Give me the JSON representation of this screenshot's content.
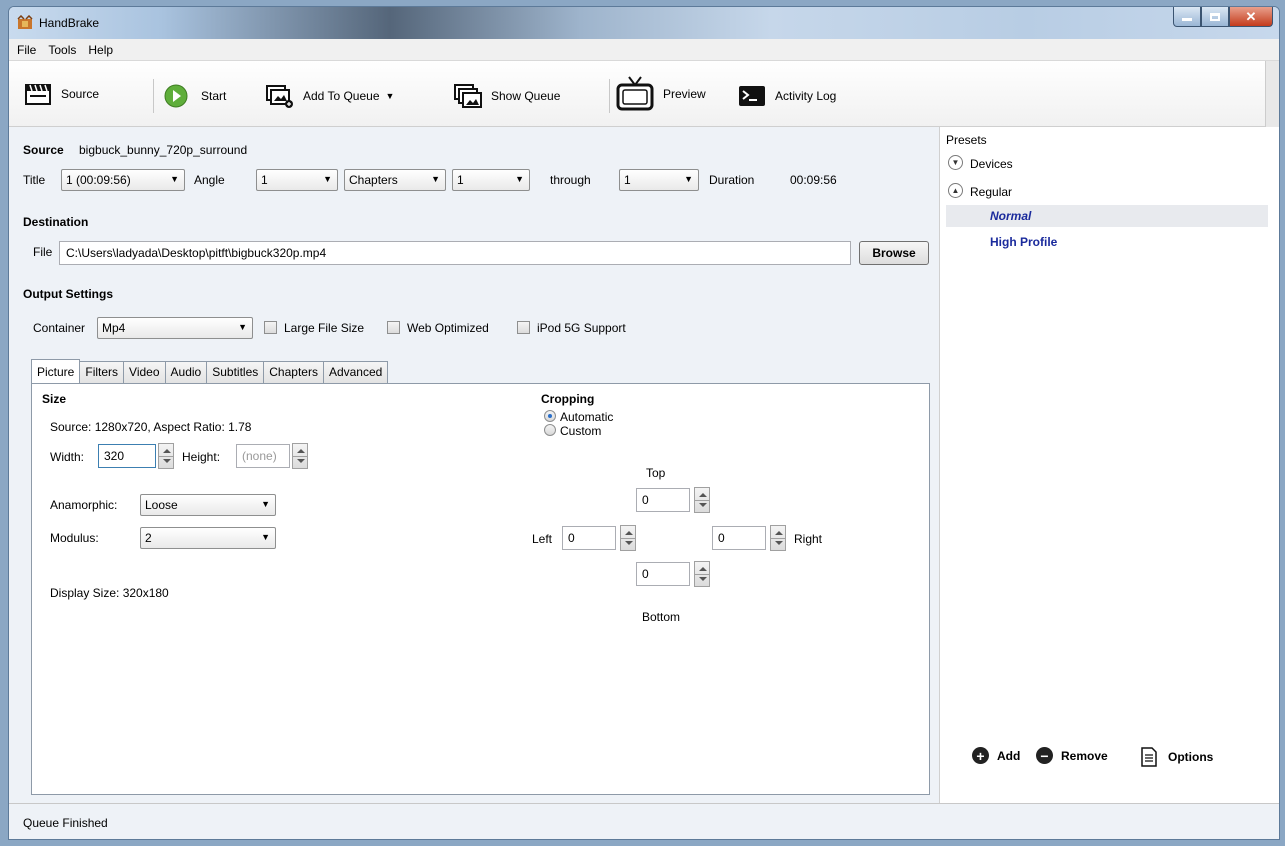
{
  "window": {
    "title": "HandBrake"
  },
  "menu": [
    "File",
    "Tools",
    "Help"
  ],
  "toolbar": {
    "source": "Source",
    "start": "Start",
    "add_to_queue": "Add To Queue",
    "show_queue": "Show Queue",
    "preview": "Preview",
    "activity_log": "Activity Log"
  },
  "source": {
    "label": "Source",
    "value": "bigbuck_bunny_720p_surround",
    "title_label": "Title",
    "title_value": "1 (00:09:56)",
    "angle_label": "Angle",
    "angle_value": "1",
    "range_mode": "Chapters",
    "range_start": "1",
    "through_label": "through",
    "range_end": "1",
    "duration_label": "Duration",
    "duration_value": "00:09:56"
  },
  "destination": {
    "heading": "Destination",
    "file_label": "File",
    "file_path": "C:\\Users\\ladyada\\Desktop\\pitft\\bigbuck320p.mp4",
    "browse": "Browse"
  },
  "output": {
    "heading": "Output Settings",
    "container_label": "Container",
    "container_value": "Mp4",
    "large_file": "Large File Size",
    "web_optimized": "Web Optimized",
    "ipod": "iPod 5G Support"
  },
  "tabs": [
    "Picture",
    "Filters",
    "Video",
    "Audio",
    "Subtitles",
    "Chapters",
    "Advanced"
  ],
  "picture": {
    "size_heading": "Size",
    "source_info": "Source:  1280x720, Aspect Ratio: 1.78",
    "width_label": "Width:",
    "width_value": "320",
    "height_label": "Height:",
    "height_value": "(none)",
    "anamorphic_label": "Anamorphic:",
    "anamorphic_value": "Loose",
    "modulus_label": "Modulus:",
    "modulus_value": "2",
    "display_size": "Display Size:  320x180",
    "cropping_heading": "Cropping",
    "automatic": "Automatic",
    "custom": "Custom",
    "top_label": "Top",
    "left_label": "Left",
    "right_label": "Right",
    "bottom_label": "Bottom",
    "top_value": "0",
    "left_value": "0",
    "right_value": "0",
    "bottom_value": "0"
  },
  "presets": {
    "heading": "Presets",
    "groups": [
      "Devices",
      "Regular"
    ],
    "items": [
      "Normal",
      "High Profile"
    ],
    "add": "Add",
    "remove": "Remove",
    "options": "Options"
  },
  "status": "Queue Finished"
}
